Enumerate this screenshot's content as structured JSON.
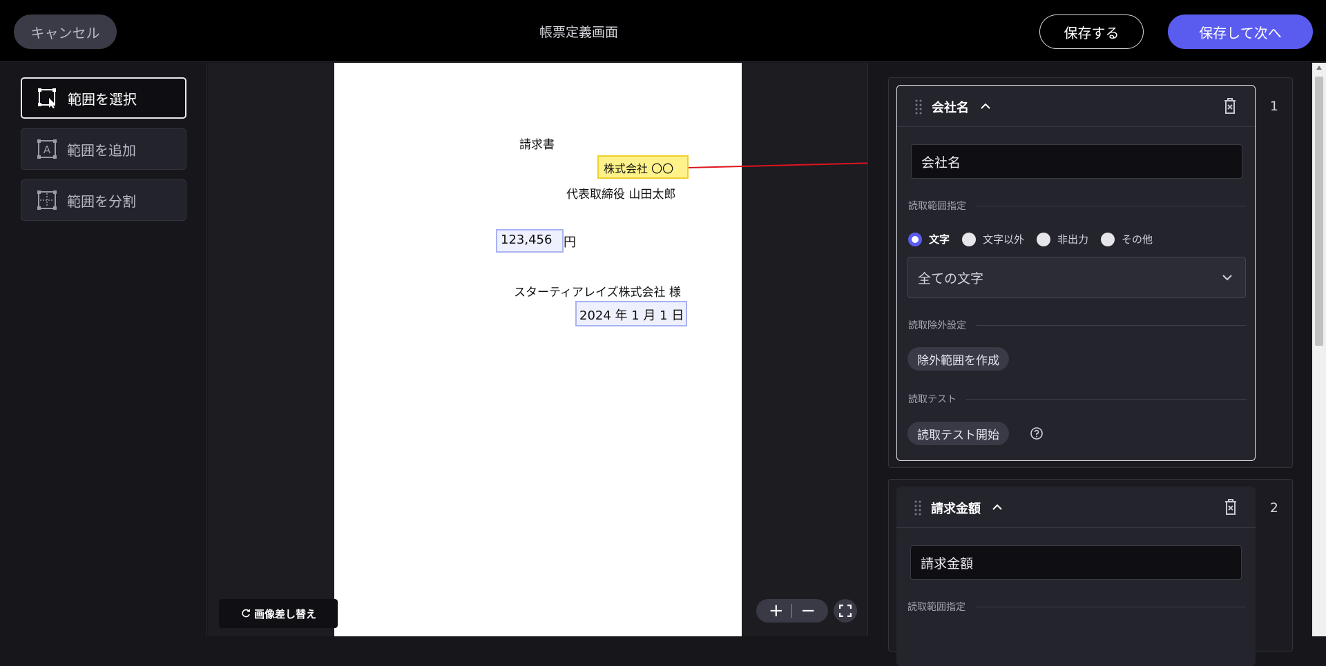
{
  "header": {
    "cancel_label": "キャンセル",
    "title": "帳票定義画面",
    "save_label": "保存する",
    "save_next_label": "保存して次へ"
  },
  "tools": [
    {
      "label": "範囲を選択",
      "icon": "select-range-icon",
      "active": true
    },
    {
      "label": "範囲を追加",
      "icon": "add-range-icon",
      "active": false
    },
    {
      "label": "範囲を分割",
      "icon": "split-range-icon",
      "active": false
    }
  ],
  "document": {
    "title": "請求書",
    "company": "株式会社 〇〇",
    "representative": "代表取締役  山田太郎",
    "amount_box": "123,456",
    "amount_suffix": "円",
    "customer": "スターティアレイズ株式会社  様",
    "date": "2024 年 1 月 1 日"
  },
  "canvas_controls": {
    "replace_image_label": "画像差し替え",
    "zoom_in": "+",
    "zoom_out": "−"
  },
  "fields": [
    {
      "number": "1",
      "title": "会社名",
      "name_value": "会社名",
      "read_range_label": "読取範囲指定",
      "radio_options": [
        "文字",
        "文字以外",
        "非出力",
        "その他"
      ],
      "selected_radio": "文字",
      "select_value": "全ての文字",
      "exclude_label": "読取除外設定",
      "exclude_button": "除外範囲を作成",
      "test_label": "読取テスト",
      "test_button": "読取テスト開始"
    },
    {
      "number": "2",
      "title": "請求金額",
      "name_value": "請求金額",
      "read_range_label": "読取範囲指定"
    }
  ],
  "colors": {
    "accent": "#5a5cf0",
    "highlight_fill": "#fff28a",
    "highlight_border": "#f1cf2c",
    "region_border": "#a9b2f2",
    "link_arrow": "#e0141e"
  }
}
